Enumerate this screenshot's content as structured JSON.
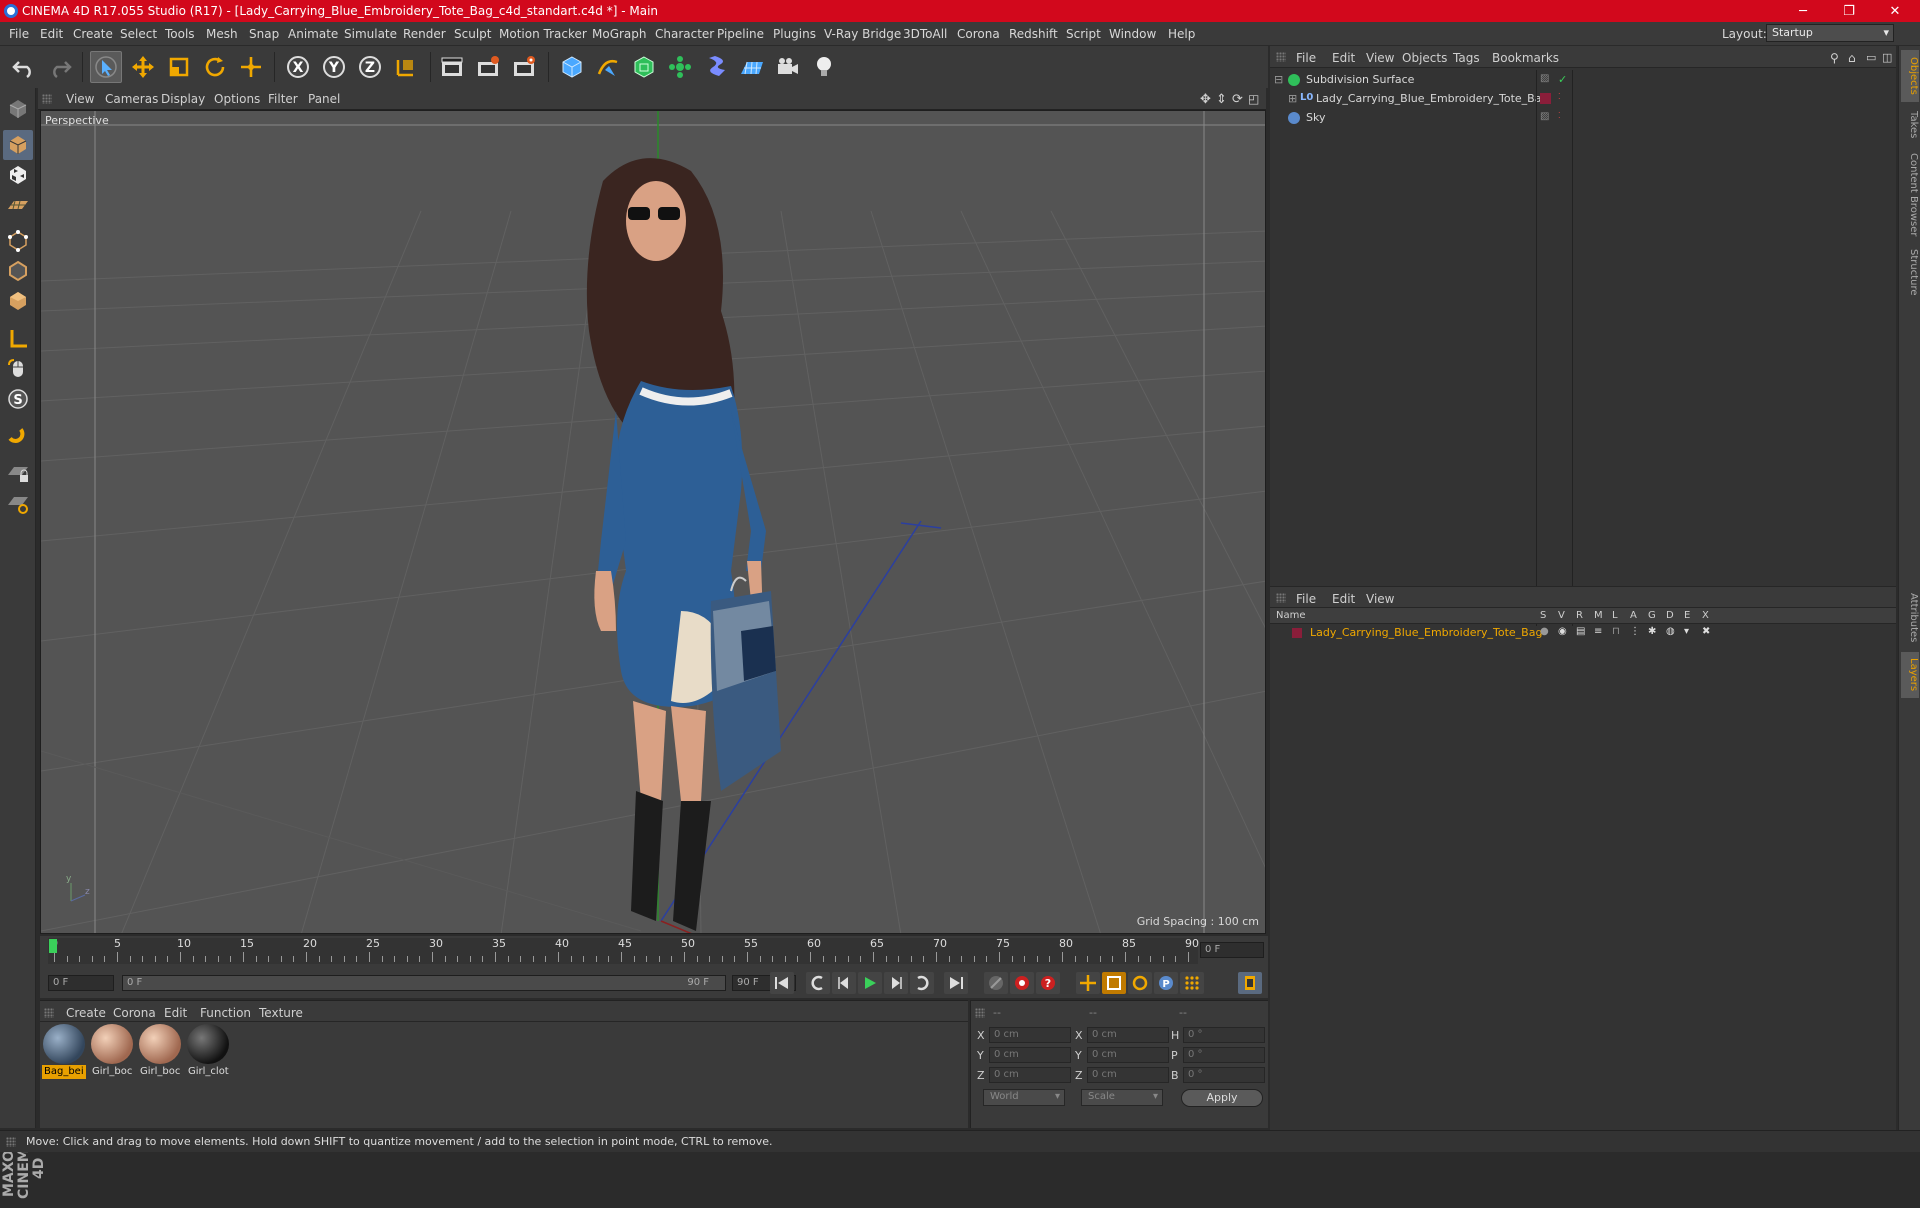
{
  "window": {
    "title": "CINEMA 4D R17.055 Studio (R17) - [Lady_Carrying_Blue_Embroidery_Tote_Bag_c4d_standart.c4d *] - Main",
    "minimize": "─",
    "maximize": "❐",
    "close": "✕"
  },
  "menu": [
    "File",
    "Edit",
    "Create",
    "Select",
    "Tools",
    "Mesh",
    "Snap",
    "Animate",
    "Simulate",
    "Render",
    "Sculpt",
    "Motion Tracker",
    "MoGraph",
    "Character",
    "Pipeline",
    "Plugins",
    "V-Ray Bridge",
    "3DToAll",
    "Corona",
    "Redshift",
    "Script",
    "Window",
    "Help"
  ],
  "layout": {
    "label": "Layout:",
    "value": "Startup"
  },
  "viewport": {
    "menu": [
      "View",
      "Cameras",
      "Display",
      "Options",
      "Filter",
      "Panel"
    ],
    "label": "Perspective",
    "grid_spacing": "Grid Spacing : 100 cm"
  },
  "timeline": {
    "ticks": [
      "0",
      "5",
      "10",
      "15",
      "20",
      "25",
      "30",
      "35",
      "40",
      "45",
      "50",
      "55",
      "60",
      "65",
      "70",
      "75",
      "80",
      "85",
      "90"
    ],
    "current_frame_field": "0 F",
    "start_field": "0 F",
    "range_start": "0 F",
    "range_end": "90 F",
    "end_field": "90 F"
  },
  "materials": {
    "menu": [
      "Create",
      "Corona",
      "Edit",
      "Function",
      "Texture"
    ],
    "items": [
      {
        "label": "Bag_bei",
        "selected": true
      },
      {
        "label": "Girl_boc",
        "selected": false
      },
      {
        "label": "Girl_boc",
        "selected": false
      },
      {
        "label": "Girl_clot",
        "selected": false
      }
    ]
  },
  "coords": {
    "headers": [
      "--",
      "--",
      "--"
    ],
    "rows": [
      {
        "a": "X",
        "av": "0 cm",
        "b": "X",
        "bv": "0 cm",
        "c": "H",
        "cv": "0 °"
      },
      {
        "a": "Y",
        "av": "0 cm",
        "b": "Y",
        "bv": "0 cm",
        "c": "P",
        "cv": "0 °"
      },
      {
        "a": "Z",
        "av": "0 cm",
        "b": "Z",
        "bv": "0 cm",
        "c": "B",
        "cv": "0 °"
      }
    ],
    "mode1": "World",
    "mode2": "Scale",
    "apply": "Apply"
  },
  "object_manager": {
    "menu": [
      "File",
      "Edit",
      "View",
      "Objects",
      "Tags",
      "Bookmarks"
    ],
    "objects": [
      {
        "name": "Subdivision Surface"
      },
      {
        "name": "Lady_Carrying_Blue_Embroidery_Tote_Bag"
      },
      {
        "name": "Sky"
      }
    ]
  },
  "layer_manager": {
    "menu": [
      "File",
      "Edit",
      "View"
    ],
    "columns": [
      "Name",
      "S",
      "V",
      "R",
      "M",
      "L",
      "A",
      "G",
      "D",
      "E",
      "X"
    ],
    "layer_name": "Lady_Carrying_Blue_Embroidery_Tote_Bag"
  },
  "right_tabs": [
    "Objects",
    "Takes",
    "Content Browser",
    "Structure",
    "Attributes",
    "Layers"
  ],
  "status": "Move: Click and drag to move elements. Hold down SHIFT to quantize movement / add to the selection in point mode, CTRL to remove.",
  "logo": "MAXON CINEMA 4D",
  "colors": {
    "title_bar": "#d2081c",
    "accent": "#e8a000",
    "viewport": "#545454"
  }
}
